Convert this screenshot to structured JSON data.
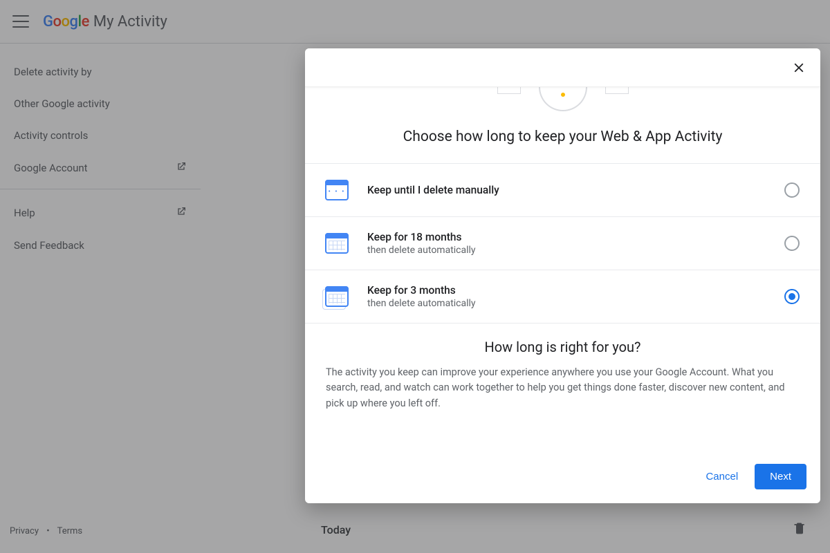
{
  "header": {
    "brand_logo_text": "Google",
    "brand_title": "My Activity"
  },
  "sidebar": {
    "items": [
      {
        "label": "Delete activity by",
        "external": false
      },
      {
        "label": "Other Google activity",
        "external": false
      },
      {
        "label": "Activity controls",
        "external": false
      },
      {
        "label": "Google Account",
        "external": true
      }
    ],
    "items2": [
      {
        "label": "Help",
        "external": true
      },
      {
        "label": "Send Feedback",
        "external": false
      }
    ]
  },
  "footer": {
    "privacy": "Privacy",
    "terms": "Terms"
  },
  "main": {
    "today_label": "Today"
  },
  "dialog": {
    "title": "Choose how long to keep your Web & App Activity",
    "options": [
      {
        "title": "Keep until I delete manually",
        "sub": "",
        "selected": false
      },
      {
        "title": "Keep for 18 months",
        "sub": "then delete automatically",
        "selected": false
      },
      {
        "title": "Keep for 3 months",
        "sub": "then delete automatically",
        "selected": true
      }
    ],
    "explain_title": "How long is right for you?",
    "explain_body": "The activity you keep can improve your experience anywhere you use your Google Account. What you search, read, and watch can work together to help you get things done faster, discover new content, and pick up where you left off.",
    "cancel": "Cancel",
    "next": "Next"
  }
}
